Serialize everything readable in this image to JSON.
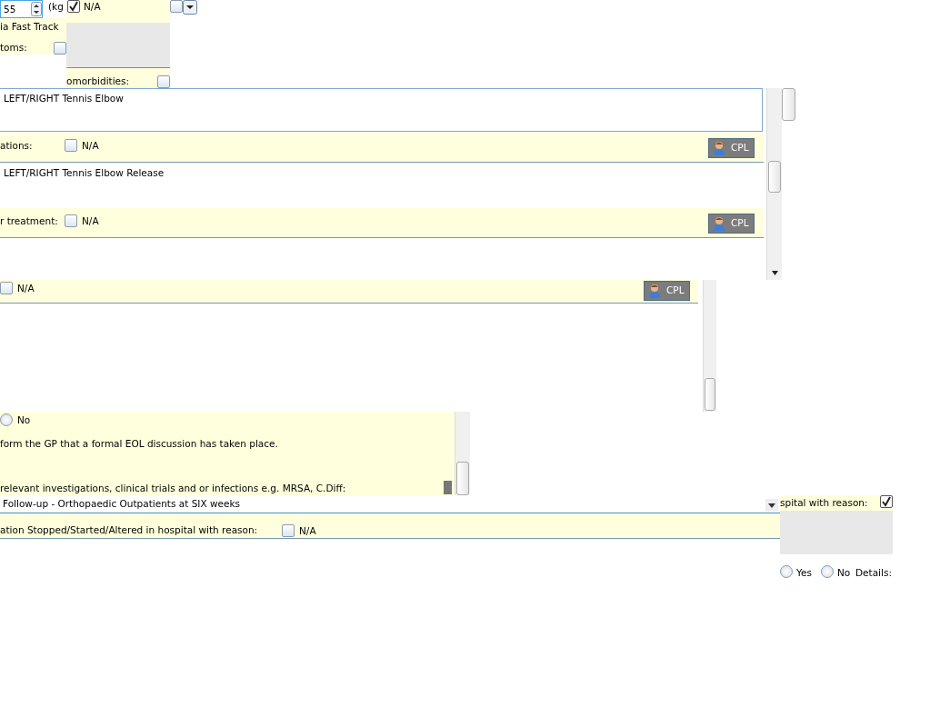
{
  "weight": {
    "value": "55",
    "unit": "(kg"
  },
  "weight_na": {
    "label": "N/A",
    "checked": true
  },
  "extra_checkbox": {
    "checked": false
  },
  "fast_track": {
    "label": "ia Fast Track"
  },
  "symptoms": {
    "label": "toms:",
    "checked": false
  },
  "comorbidities": {
    "label": "omorbidities:",
    "checked": false
  },
  "main_panel": {
    "diagnosis": "LEFT/RIGHT Tennis Elbow",
    "sections": [
      {
        "label": "ations:",
        "na": {
          "label": "N/A",
          "checked": false
        },
        "button": "CPL",
        "text": "LEFT/RIGHT Tennis Elbow Release"
      },
      {
        "label": "r treatment:",
        "na": {
          "label": "N/A",
          "checked": false
        },
        "button": "CPL"
      }
    ]
  },
  "second_panel": {
    "na": {
      "label": "N/A",
      "checked": false
    },
    "button": "CPL"
  },
  "eol_panel": {
    "radio": {
      "label": "No",
      "selected": false
    },
    "note": "form the GP that a formal EOL discussion has taken place.",
    "investigations_label": "relevant investigations, clinical trials and or infections e.g. MRSA, C.Diff:"
  },
  "follow_up": {
    "value": "Follow-up - Orthopaedic Outpatients at SIX weeks"
  },
  "medication": {
    "label": "ation Stopped/Started/Altered in hospital with reason:",
    "na": {
      "label": "N/A",
      "checked": false
    }
  },
  "right_panel": {
    "label": "spital with reason:",
    "checked": true,
    "radios": [
      {
        "label": "Yes",
        "selected": false
      },
      {
        "label": "No",
        "selected": false
      }
    ],
    "details_label": "Details:"
  }
}
